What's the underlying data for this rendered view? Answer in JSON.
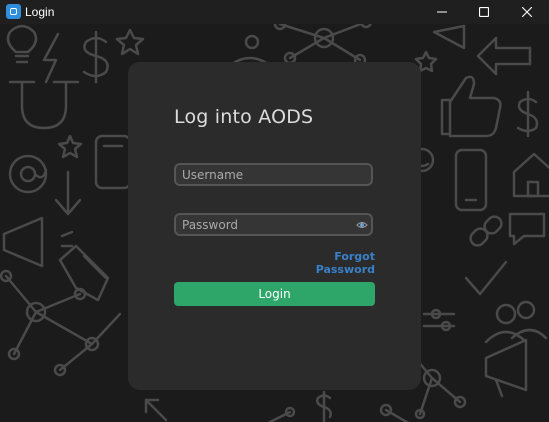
{
  "window": {
    "title": "Login",
    "controls": [
      "minimize-icon",
      "maximize-icon",
      "close-icon"
    ]
  },
  "background": {
    "icons": [
      "lightbulb-icon",
      "dollar-icon",
      "network-icon",
      "magnet-icon",
      "email-at-icon",
      "phone-icon",
      "thumbs-up-icon",
      "megaphone-icon",
      "house-icon",
      "link-icon",
      "people-icon",
      "arrow-icon",
      "star-icon",
      "pencil-icon"
    ]
  },
  "login": {
    "title": "Log into AODS",
    "username_placeholder": "Username",
    "password_placeholder": "Password",
    "forgot_password": "Forgot Password",
    "login_button": "Login"
  },
  "colors": {
    "card": "#2b2b2b",
    "button": "#2ea66a",
    "link": "#3a80c8",
    "app_icon": "#2f8fdc"
  }
}
